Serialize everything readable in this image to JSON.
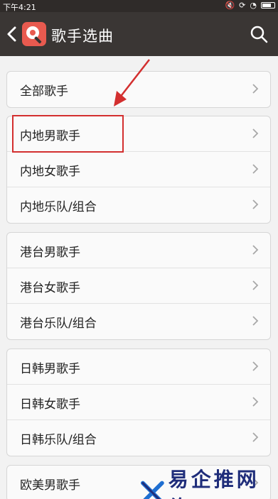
{
  "status_bar": {
    "time": "下午4:21"
  },
  "app_bar": {
    "title": "歌手选曲"
  },
  "groups": [
    {
      "items": [
        {
          "label": "全部歌手"
        }
      ]
    },
    {
      "items": [
        {
          "label": "内地男歌手"
        },
        {
          "label": "内地女歌手"
        },
        {
          "label": "内地乐队/组合"
        }
      ]
    },
    {
      "items": [
        {
          "label": "港台男歌手"
        },
        {
          "label": "港台女歌手"
        },
        {
          "label": "港台乐队/组合"
        }
      ]
    },
    {
      "items": [
        {
          "label": "日韩男歌手"
        },
        {
          "label": "日韩女歌手"
        },
        {
          "label": "日韩乐队/组合"
        }
      ]
    },
    {
      "items": [
        {
          "label": "欧美男歌手"
        }
      ]
    }
  ],
  "watermark": {
    "text": "易企推网络"
  },
  "colors": {
    "app_bar": "#3a3634",
    "highlight": "#d32f2f",
    "logo": "#e85a4f"
  }
}
